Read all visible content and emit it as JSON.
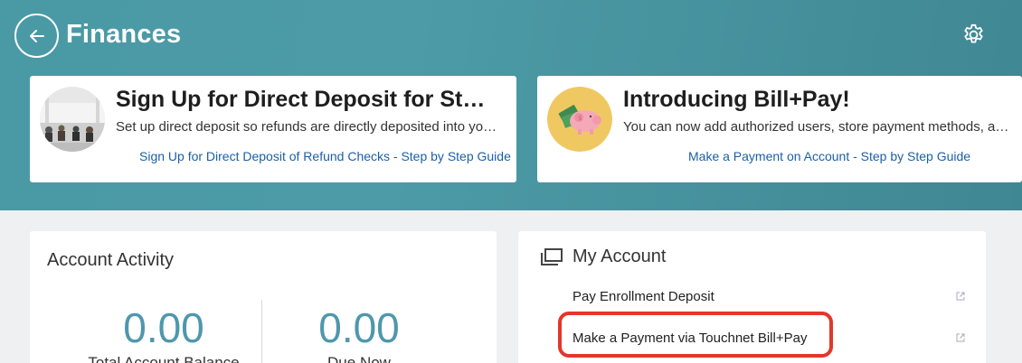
{
  "header": {
    "title": "Finances",
    "back_icon": "arrow-left-icon",
    "settings_icon": "gear-icon"
  },
  "promos": [
    {
      "title": "Sign Up for Direct Deposit for Students",
      "description": "Set up direct deposit so refunds are directly deposited into your checking account.",
      "link": "Sign Up for Direct Deposit of Refund Checks - Step by Step Guide"
    },
    {
      "title": "Introducing Bill+Pay!",
      "description": "You can now add authorized users, store payment methods, and more.",
      "link": "Make a Payment on Account - Step by Step Guide"
    }
  ],
  "activity": {
    "title": "Account Activity",
    "total_balance_value": "0.00",
    "total_balance_label": "Total Account Balance",
    "due_now_value": "0.00",
    "due_now_label": "Due Now"
  },
  "account": {
    "title": "My Account",
    "items": [
      {
        "label": "Pay Enrollment Deposit"
      },
      {
        "label": "Make a Payment via Touchnet Bill+Pay"
      }
    ]
  },
  "colors": {
    "header_teal": "#4a9aa6",
    "link_blue": "#1b5fa8",
    "number_blue": "#4f97ad",
    "highlight_red": "#e2372b"
  }
}
